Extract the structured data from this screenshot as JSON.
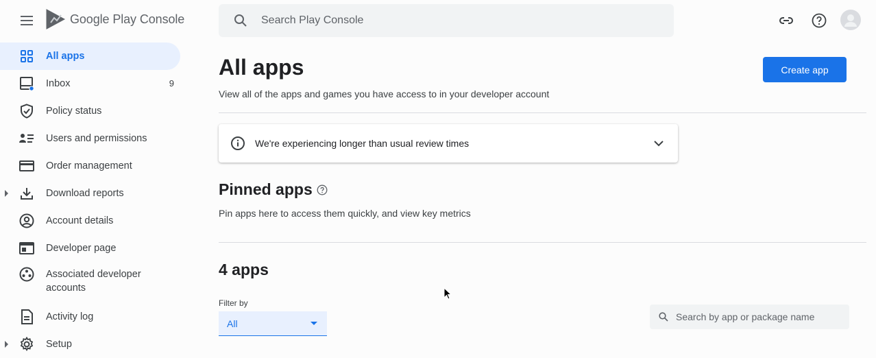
{
  "header": {
    "logo_text": "Google Play Console",
    "search_placeholder": "Search Play Console"
  },
  "sidebar": {
    "items": [
      {
        "label": "All apps",
        "icon": "grid-icon",
        "active": true
      },
      {
        "label": "Inbox",
        "icon": "inbox-icon",
        "count": "9"
      },
      {
        "label": "Policy status",
        "icon": "shield-check-icon"
      },
      {
        "label": "Users and permissions",
        "icon": "users-list-icon"
      },
      {
        "label": "Order management",
        "icon": "credit-card-icon"
      },
      {
        "label": "Download reports",
        "icon": "download-icon",
        "expandable": true
      },
      {
        "label": "Account details",
        "icon": "account-circle-icon"
      },
      {
        "label": "Developer page",
        "icon": "web-page-icon"
      },
      {
        "label": "Associated developer accounts",
        "icon": "linked-accounts-icon"
      },
      {
        "label": "Activity log",
        "icon": "document-icon"
      },
      {
        "label": "Setup",
        "icon": "gear-icon",
        "expandable": true
      }
    ]
  },
  "main": {
    "title": "All apps",
    "subtitle": "View all of the apps and games you have access to in your developer account",
    "create_button": "Create app",
    "notice": "We're experiencing longer than usual review times",
    "pinned_title": "Pinned apps",
    "pinned_sub": "Pin apps here to access them quickly, and view key metrics",
    "apps_title": "4 apps",
    "filter_label": "Filter by",
    "filter_value": "All",
    "app_search_placeholder": "Search by app or package name"
  },
  "colors": {
    "accent": "#1a73e8",
    "active_bg": "#e8f0fe"
  }
}
